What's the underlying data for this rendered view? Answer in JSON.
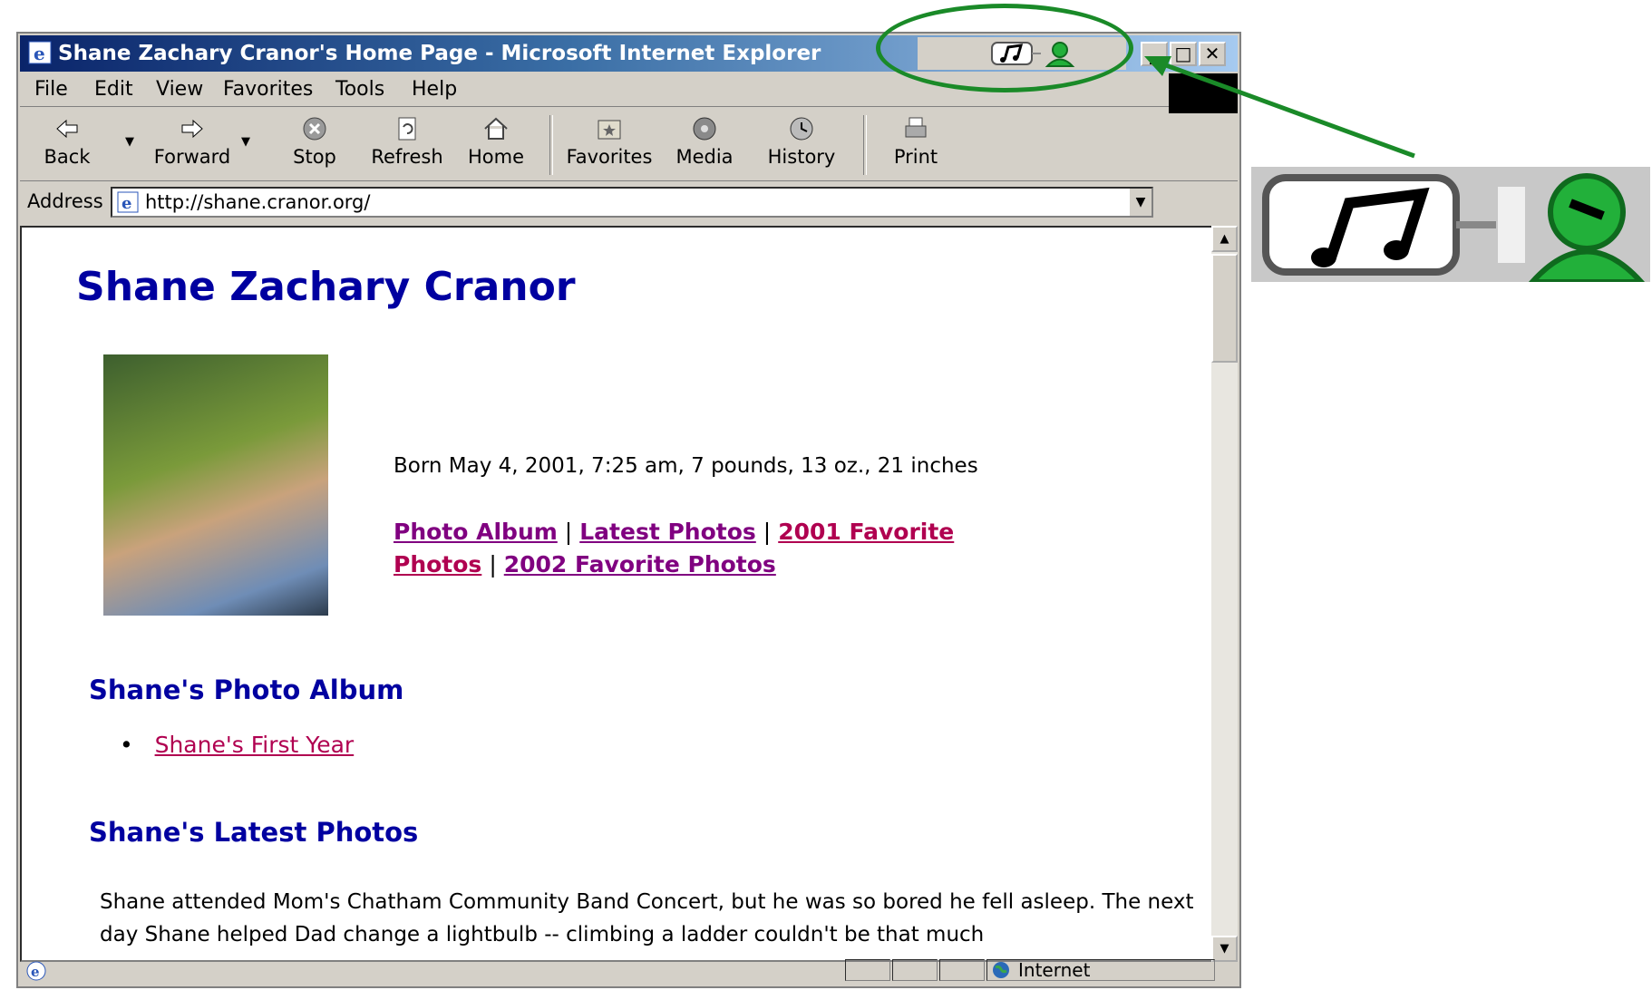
{
  "window": {
    "title": "Shane Zachary Cranor's Home Page - Microsoft Internet Explorer"
  },
  "menu": [
    "File",
    "Edit",
    "View",
    "Favorites",
    "Tools",
    "Help"
  ],
  "toolbar": {
    "back": "Back",
    "forward": "Forward",
    "stop": "Stop",
    "refresh": "Refresh",
    "home": "Home",
    "favorites": "Favorites",
    "media": "Media",
    "history": "History",
    "print": "Print"
  },
  "address": {
    "label": "Address",
    "url": "http://shane.cranor.org/"
  },
  "page": {
    "heading": "Shane Zachary Cranor",
    "born": "Born May 4, 2001, 7:25 am, 7 pounds, 13 oz., 21 inches",
    "links": {
      "photo_album": "Photo Album",
      "latest_photos": "Latest Photos",
      "favorites_2001": "2001 Favorite Photos",
      "favorites_2002": "2002 Favorite Photos",
      "separator": "|"
    },
    "section_album": "Shane's Photo Album",
    "album_item": "Shane's First Year",
    "section_latest": "Shane's Latest Photos",
    "latest_text": "Shane attended Mom's Chatham Community Band Concert, but he was so bored he fell asleep. The next day Shane helped Dad change a lightbulb -- climbing a ladder couldn't be that much"
  },
  "status": {
    "zone": "Internet"
  },
  "colors": {
    "annotation": "#1a8a28",
    "heading": "#0000a0",
    "visited_link": "#800080"
  },
  "icons": [
    "ie-icon",
    "music-notes-icon",
    "green-person-icon",
    "minimize-icon",
    "maximize-icon",
    "close-icon",
    "back-icon",
    "forward-icon",
    "stop-icon",
    "refresh-icon",
    "home-icon",
    "favorites-icon",
    "media-icon",
    "history-icon",
    "print-icon",
    "globe-icon"
  ]
}
